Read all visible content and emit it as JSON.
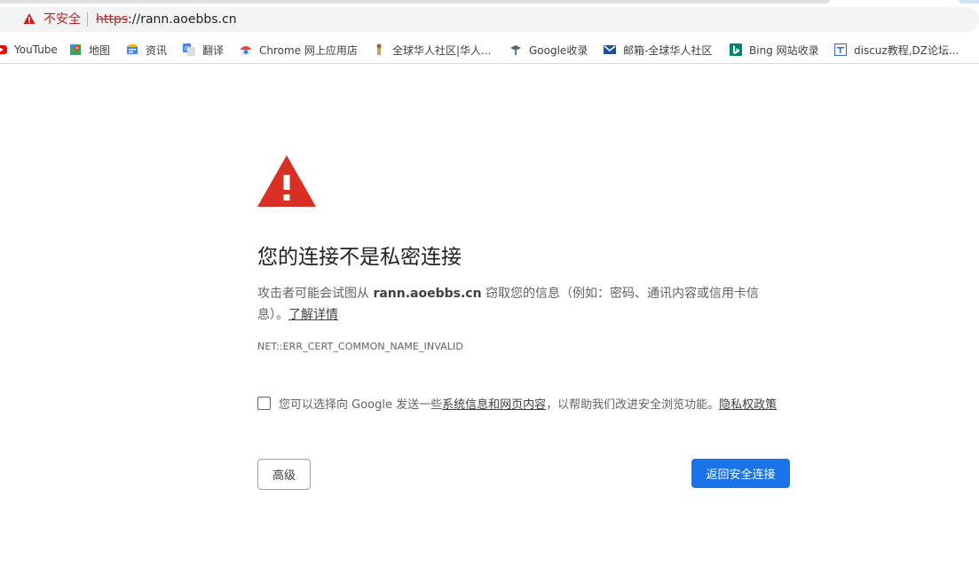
{
  "browser": {
    "security_label": "不安全",
    "url_scheme": "https",
    "url_rest": "://rann.aoebbs.cn"
  },
  "bookmarks": [
    {
      "label": "YouTube",
      "icon": "youtube-icon",
      "color": "#ff0000"
    },
    {
      "label": "地图",
      "icon": "maps-icon",
      "color": "#34a853"
    },
    {
      "label": "资讯",
      "icon": "news-icon",
      "color": "#4285f4"
    },
    {
      "label": "翻译",
      "icon": "translate-icon",
      "color": "#4285f4"
    },
    {
      "label": "Chrome 网上应用店",
      "icon": "webstore-icon",
      "color": "#ea4335"
    },
    {
      "label": "全球华人社区|华人...",
      "icon": "community-icon",
      "color": "#c8a25a"
    },
    {
      "label": "Google收录",
      "icon": "search-console-icon",
      "color": "#5f6368"
    },
    {
      "label": "邮箱-全球华人社区",
      "icon": "mail-icon",
      "color": "#1a4fa0"
    },
    {
      "label": "Bing 网站收录",
      "icon": "bing-icon",
      "color": "#008373"
    },
    {
      "label": "discuz教程,DZ论坛...",
      "icon": "discuz-icon",
      "color": "#3367d6"
    }
  ],
  "interstitial": {
    "title": "您的连接不是私密连接",
    "desc_prefix": "攻击者可能会试图从 ",
    "desc_host": "rann.aoebbs.cn",
    "desc_suffix": " 窃取您的信息（例如：密码、通讯内容或信用卡信息）。",
    "learn_more": "了解详情",
    "error_code": "NET::ERR_CERT_COMMON_NAME_INVALID",
    "optin_prefix": "您可以选择向 Google 发送一些",
    "optin_link": "系统信息和网页内容",
    "optin_middle": "，以帮助我们改进安全浏览功能。",
    "privacy_link": "隐私权政策",
    "advanced_button": "高级",
    "back_button": "返回安全连接"
  },
  "colors": {
    "warning_red": "#d93025",
    "primary_blue": "#1a73e8"
  }
}
